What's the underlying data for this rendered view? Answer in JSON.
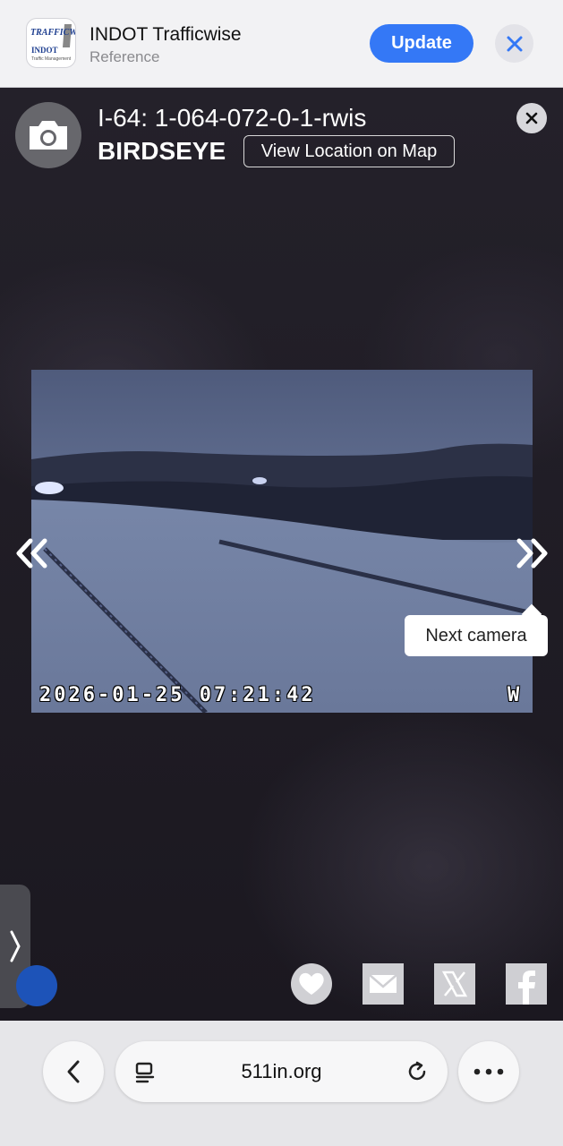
{
  "banner": {
    "logo_text_top": "TRAFFICWISE",
    "logo_text_mid": "INDOT",
    "logo_text_bot": "Traffic Management",
    "app_name": "INDOT Trafficwise",
    "app_category": "Reference",
    "update_label": "Update",
    "close_icon": "close-icon"
  },
  "camera": {
    "title": "I-64: 1-064-072-0-1-rwis",
    "subtitle": "BIRDSEYE",
    "map_button_label": "View Location on Map",
    "timestamp": "2026-01-25 07:21:42",
    "direction": "W",
    "next_tooltip": "Next camera",
    "icons": {
      "badge": "camera-icon",
      "prev": "double-chevron-left-icon",
      "next": "double-chevron-right-icon",
      "close": "close-icon"
    }
  },
  "share": {
    "icons": [
      "heart-icon",
      "mail-icon",
      "x-logo-icon",
      "facebook-icon"
    ]
  },
  "browser": {
    "url": "511in.org",
    "icons": {
      "back": "chevron-left-icon",
      "tabs": "tabs-icon",
      "reload": "reload-icon",
      "more": "more-icon"
    }
  },
  "colors": {
    "accent_blue": "#3478f6",
    "overlay_bg": "#1d1a22",
    "snow": "#6f7e9f"
  }
}
